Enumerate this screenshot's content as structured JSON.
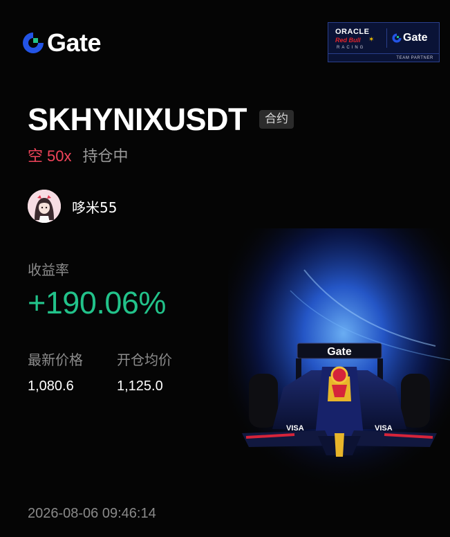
{
  "brand": {
    "name": "Gate",
    "logo_icon": "gate-logo-icon",
    "accent": "#2354e6"
  },
  "partner_badge": {
    "line1": "ORACLE",
    "line2": "Red Bull",
    "line3": "RACING",
    "brand": "Gate",
    "caption": "TEAM PARTNER"
  },
  "position": {
    "symbol": "SKHYNIXUSDT",
    "contract_type": "合约",
    "side": "空",
    "leverage": "50x",
    "status": "持仓中",
    "side_color": "#f0445a"
  },
  "user": {
    "name": "哆米55",
    "avatar_icon": "avatar-girl-icon"
  },
  "yield": {
    "label": "收益率",
    "value": "+190.06%",
    "color": "#22c28a"
  },
  "prices": {
    "latest_label": "最新价格",
    "latest_value": "1,080.6",
    "entry_label": "开仓均价",
    "entry_value": "1,125.0"
  },
  "timestamp": "2026-08-06 09:46:14",
  "hero": {
    "icon": "f1-race-car-illustration",
    "car_wing_text": "Gate"
  }
}
